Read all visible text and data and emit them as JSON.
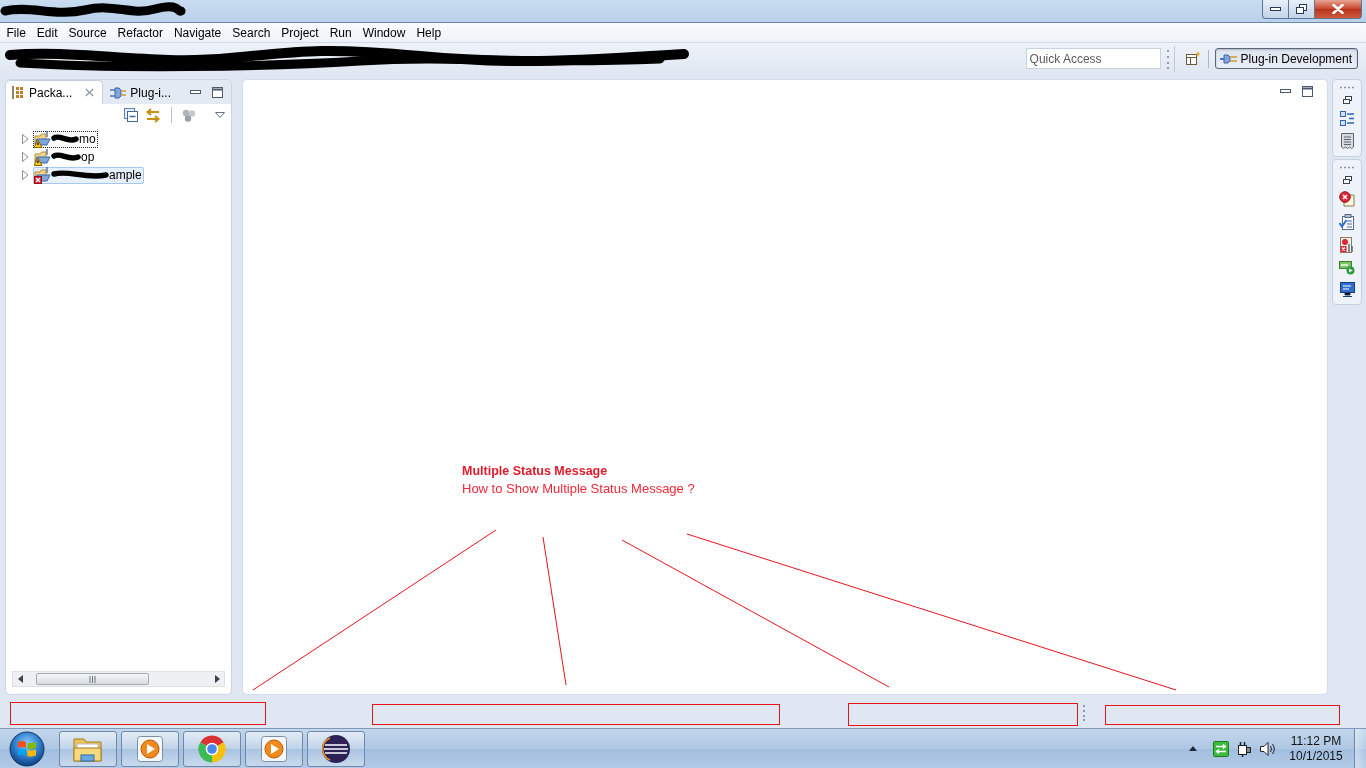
{
  "menu_bar": {
    "items": [
      "File",
      "Edit",
      "Source",
      "Refactor",
      "Navigate",
      "Search",
      "Project",
      "Run",
      "Window",
      "Help"
    ]
  },
  "toolbar": {
    "quick_access": {
      "placeholder": "Quick Access"
    },
    "perspective": {
      "label": "Plug-in Development",
      "selected": true
    }
  },
  "package_explorer": {
    "tabs": [
      {
        "label": "Packa...",
        "selected": true
      },
      {
        "label": "Plug-i...",
        "selected": false
      }
    ],
    "tree": [
      {
        "label": "mo",
        "kind": "warning",
        "expanded": false,
        "selected": false,
        "focused": true
      },
      {
        "label": "op",
        "kind": "warning",
        "expanded": false,
        "selected": false,
        "focused": false
      },
      {
        "label": "ample",
        "kind": "error",
        "expanded": false,
        "selected": true,
        "focused": false
      }
    ]
  },
  "annotation": {
    "title": "Multiple Status Message",
    "text": "How to Show Multiple Status Message ?"
  },
  "taskbar": {
    "clock": {
      "time": "11:12 PM",
      "date": "10/1/2015"
    }
  }
}
